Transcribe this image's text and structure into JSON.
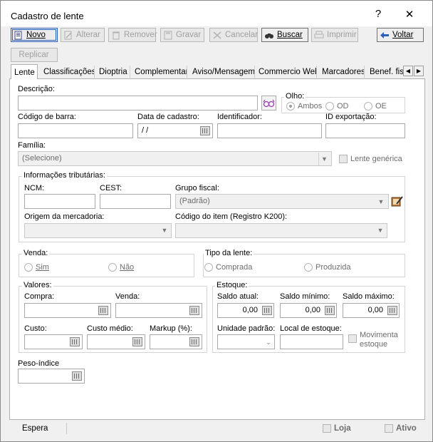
{
  "window": {
    "title": "Cadastro de lente",
    "help": "?",
    "close": "✕"
  },
  "toolbar": {
    "novo": "Novo",
    "alterar": "Alterar",
    "remover": "Remover",
    "gravar": "Gravar",
    "cancelar": "Cancelar",
    "buscar": "Buscar",
    "imprimir": "Imprimir",
    "voltar": "Voltar",
    "replicar": "Replicar"
  },
  "tabs": [
    "Lente",
    "Classificações",
    "Dioptria",
    "Complementar",
    "Aviso/Mensagem",
    "Commercio Web",
    "Marcadores",
    "Benef. fis"
  ],
  "form": {
    "descricao_label": "Descrição:",
    "descricao_value": "",
    "olho_label": "Olho:",
    "olho_options": [
      "Ambos",
      "OD",
      "OE"
    ],
    "codigo_barra_label": "Código de barra:",
    "data_cadastro_label": "Data de cadastro:",
    "data_cadastro_value": "/ /",
    "identificador_label": "Identificador:",
    "id_exportacao_label": "ID exportação:",
    "familia_label": "Família:",
    "familia_value": "(Selecione)",
    "lente_generica_label": "Lente genérica",
    "trib_title": "Informações tributárias:",
    "ncm_label": "NCM:",
    "cest_label": "CEST:",
    "grupo_fiscal_label": "Grupo fiscal:",
    "grupo_fiscal_value": "(Padrão)",
    "origem_label": "Origem da mercadoria:",
    "codigo_item_label": "Código do item (Registro K200):",
    "venda_title": "Venda:",
    "venda_sim": "Sim",
    "venda_nao": "Não",
    "tipo_lente_title": "Tipo da lente:",
    "tipo_comprada": "Comprada",
    "tipo_produzida": "Produzida",
    "valores_title": "Valores:",
    "compra_label": "Compra:",
    "venda_label": "Venda:",
    "custo_label": "Custo:",
    "custo_medio_label": "Custo médio:",
    "markup_label": "Markup (%):",
    "estoque_title": "Estoque:",
    "saldo_atual_label": "Saldo atual:",
    "saldo_minimo_label": "Saldo mínimo:",
    "saldo_maximo_label": "Saldo máximo:",
    "saldo_atual_value": "0,00",
    "saldo_minimo_value": "0,00",
    "saldo_maximo_value": "0,00",
    "unidade_padrao_label": "Unidade padrão:",
    "local_estoque_label": "Local de estoque:",
    "movimenta_estoque_label": "Movimenta estoque",
    "peso_indice_label": "Peso-índice"
  },
  "status": {
    "text": "Espera",
    "loja": "Loja",
    "ativo": "Ativo"
  },
  "colors": {
    "accent": "#2b5eb8",
    "disabled_text": "#a0a0a0"
  }
}
